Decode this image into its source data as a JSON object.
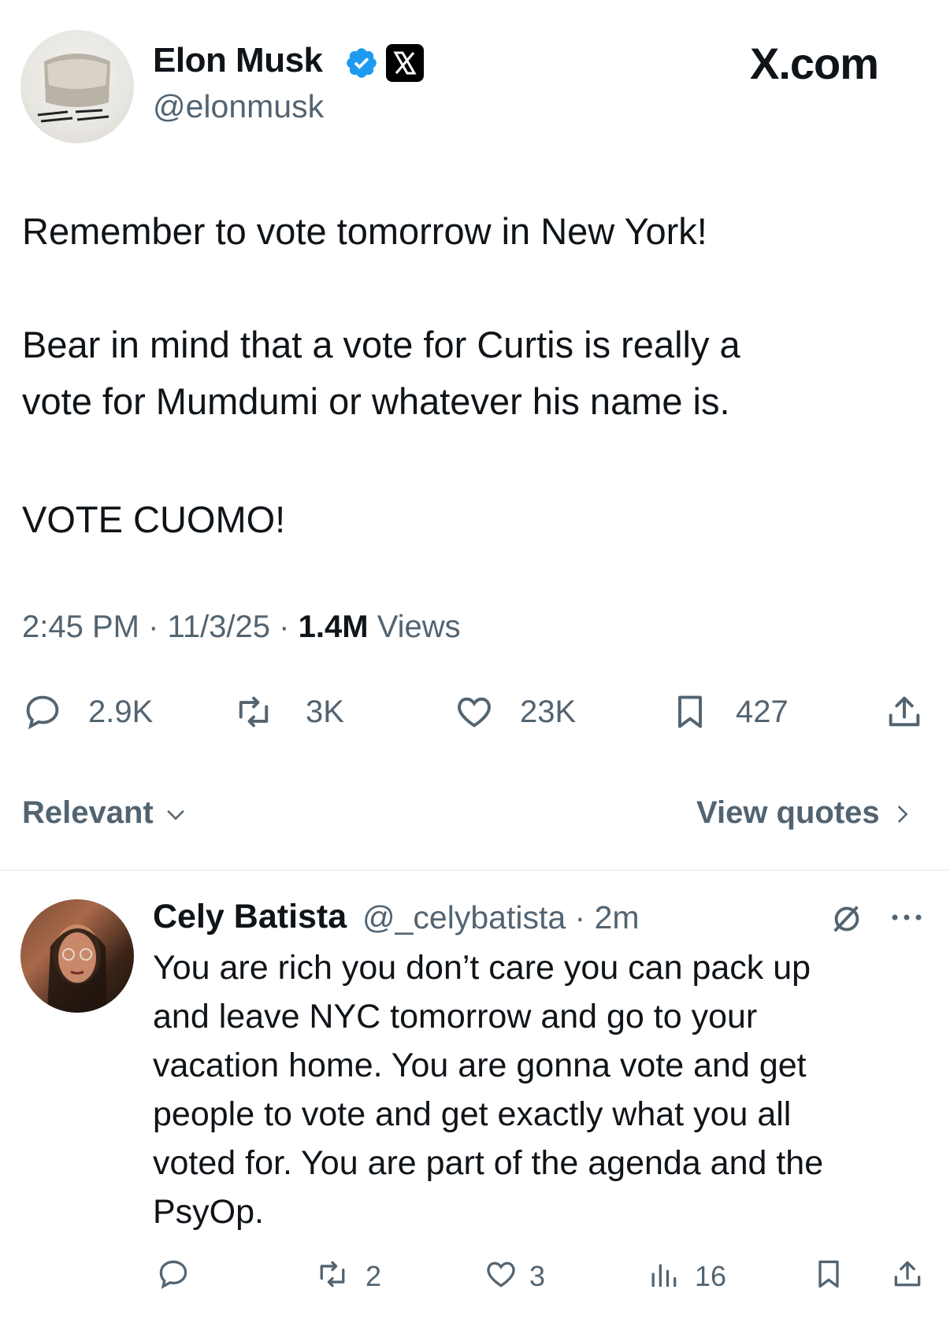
{
  "tweet": {
    "author": {
      "name": "Elon Musk",
      "handle": "@elonmusk",
      "verified_icon": "verified-badge-icon",
      "affiliate_icon": "x-logo-icon"
    },
    "brand": "X.com",
    "body_lines": [
      "Remember to vote tomorrow in New York!",
      "Bear in mind that a vote for Curtis is really a",
      "vote for Mumdumi or whatever his name is.",
      "VOTE CUOMO!"
    ],
    "time": "2:45 PM",
    "date": "11/3/25",
    "separator": "·",
    "views_count": "1.4M",
    "views_label": "Views",
    "actions": {
      "replies": "2.9K",
      "reposts": "3K",
      "likes": "23K",
      "bookmarks": "427"
    }
  },
  "sort": {
    "label": "Relevant",
    "view_quotes": "View quotes"
  },
  "reply": {
    "name": "Cely Batista",
    "handle": "@_celybatista",
    "separator": "·",
    "time": "2m",
    "lines": [
      "You are rich you don’t care you can pack up",
      "and leave NYC tomorrow and go to your",
      "vacation home. You are gonna vote and get",
      "people to vote and get exactly what you all",
      "voted for. You are part of the agenda and the",
      "PsyOp."
    ],
    "actions": {
      "reposts": "2",
      "likes": "3",
      "views": "16"
    }
  },
  "colors": {
    "text": "#0f1419",
    "secondary": "#536471",
    "verified": "#1d9bf0",
    "divider": "#eff3f4"
  }
}
